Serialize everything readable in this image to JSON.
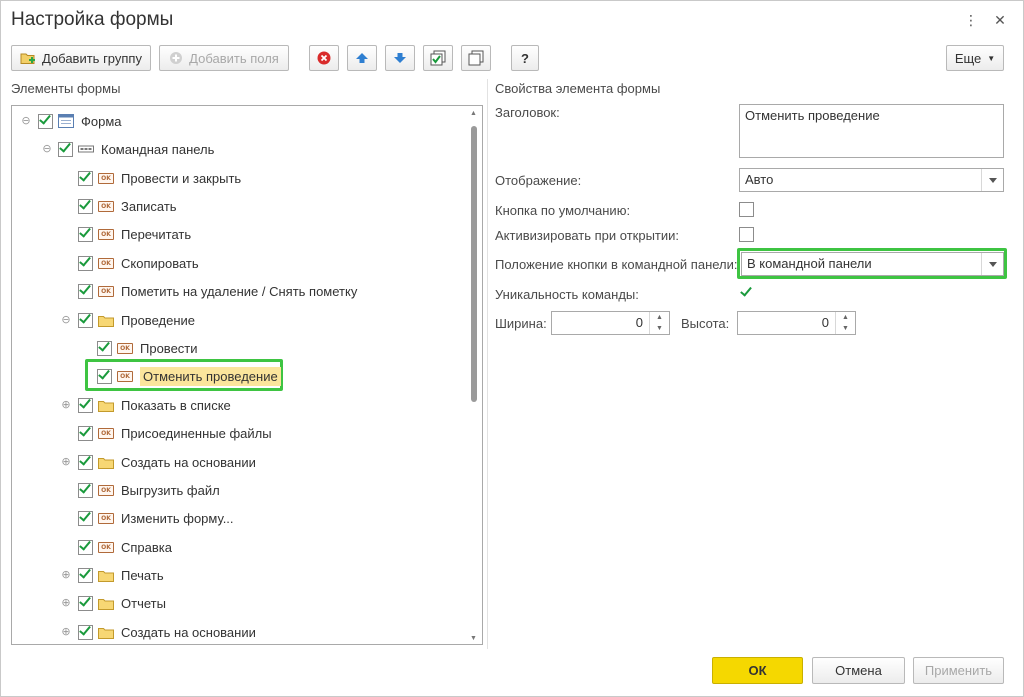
{
  "window": {
    "title": "Настройка формы"
  },
  "toolbar": {
    "add_group_label": "Добавить группу",
    "add_fields_label": "Добавить поля",
    "help_label": "?",
    "more_label": "Еще"
  },
  "left_panel": {
    "header": "Элементы формы"
  },
  "tree": {
    "root": "Форма",
    "command_panel": "Командная панель",
    "items": {
      "post_and_close": "Провести и закрыть",
      "write": "Записать",
      "reread": "Перечитать",
      "copy": "Скопировать",
      "mark_delete": "Пометить на удаление / Снять пометку",
      "posting": "Проведение",
      "post": "Провести",
      "cancel_posting": "Отменить проведение",
      "show_in_list": "Показать в списке",
      "attached_files": "Присоединенные файлы",
      "create_based_on": "Создать на основании",
      "export_file": "Выгрузить файл",
      "change_form": "Изменить форму...",
      "help": "Справка",
      "print": "Печать",
      "reports": "Отчеты",
      "create_based_on_2": "Создать на основании"
    }
  },
  "right_panel": {
    "header": "Свойства элемента формы",
    "caption_label": "Заголовок:",
    "caption_value": "Отменить проведение",
    "display_label": "Отображение:",
    "display_value": "Авто",
    "default_button_label": "Кнопка по умолчанию:",
    "activate_label": "Активизировать при открытии:",
    "position_label": "Положение кнопки в командной панели:",
    "position_value": "В командной панели",
    "uniqueness_label": "Уникальность команды:",
    "width_label": "Ширина:",
    "width_value": "0",
    "height_label": "Высота:",
    "height_value": "0"
  },
  "footer": {
    "ok_label": "ОК",
    "cancel_label": "Отмена",
    "apply_label": "Применить"
  },
  "colors": {
    "highlight": "#3ec442",
    "selection": "#fbe59c",
    "ok_button": "#f5d800",
    "checkmark": "#1a9a3c"
  }
}
